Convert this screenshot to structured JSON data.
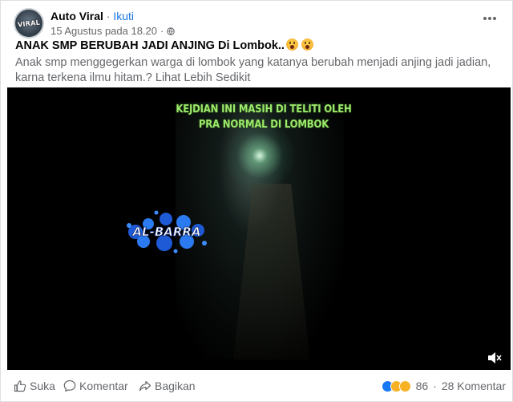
{
  "post": {
    "page_name": "Auto Viral",
    "separator": "·",
    "follow_label": "Ikuti",
    "timestamp": "15 Agustus pada 18.20",
    "privacy_separator": "·",
    "title": "ANAK SMP BERUBAH JADI ANJING Di Lombok..",
    "title_emojis": [
      "surprised-face-icon",
      "surprised-face-icon"
    ],
    "body_text": "Anak smp menggegerkan warga di lombok yang katanya berubah menjadi anjing jadi jadian, karna terkena ilmu hitam.?",
    "see_more_label": "Lihat Lebih Sedikit",
    "avatar_text": "VIRAL"
  },
  "video": {
    "overlay_line1": "KEJDIAN INI MASIH DI TELITI OLEH",
    "overlay_line2": "PRA NORMAL DI LOMBOK",
    "logo_text": "AL-BARRA",
    "mute_icon": "volume-muted-icon"
  },
  "actions": {
    "like_label": "Suka",
    "comment_label": "Komentar",
    "share_label": "Bagikan"
  },
  "reactions": {
    "types": [
      "like-icon",
      "sad-icon",
      "haha-icon"
    ],
    "count": "86",
    "separator": "·",
    "comments": "28 Komentar"
  },
  "colors": {
    "link_blue": "#1b74e4",
    "text_secondary": "#65676b",
    "overlay_green": "#9be86b"
  }
}
